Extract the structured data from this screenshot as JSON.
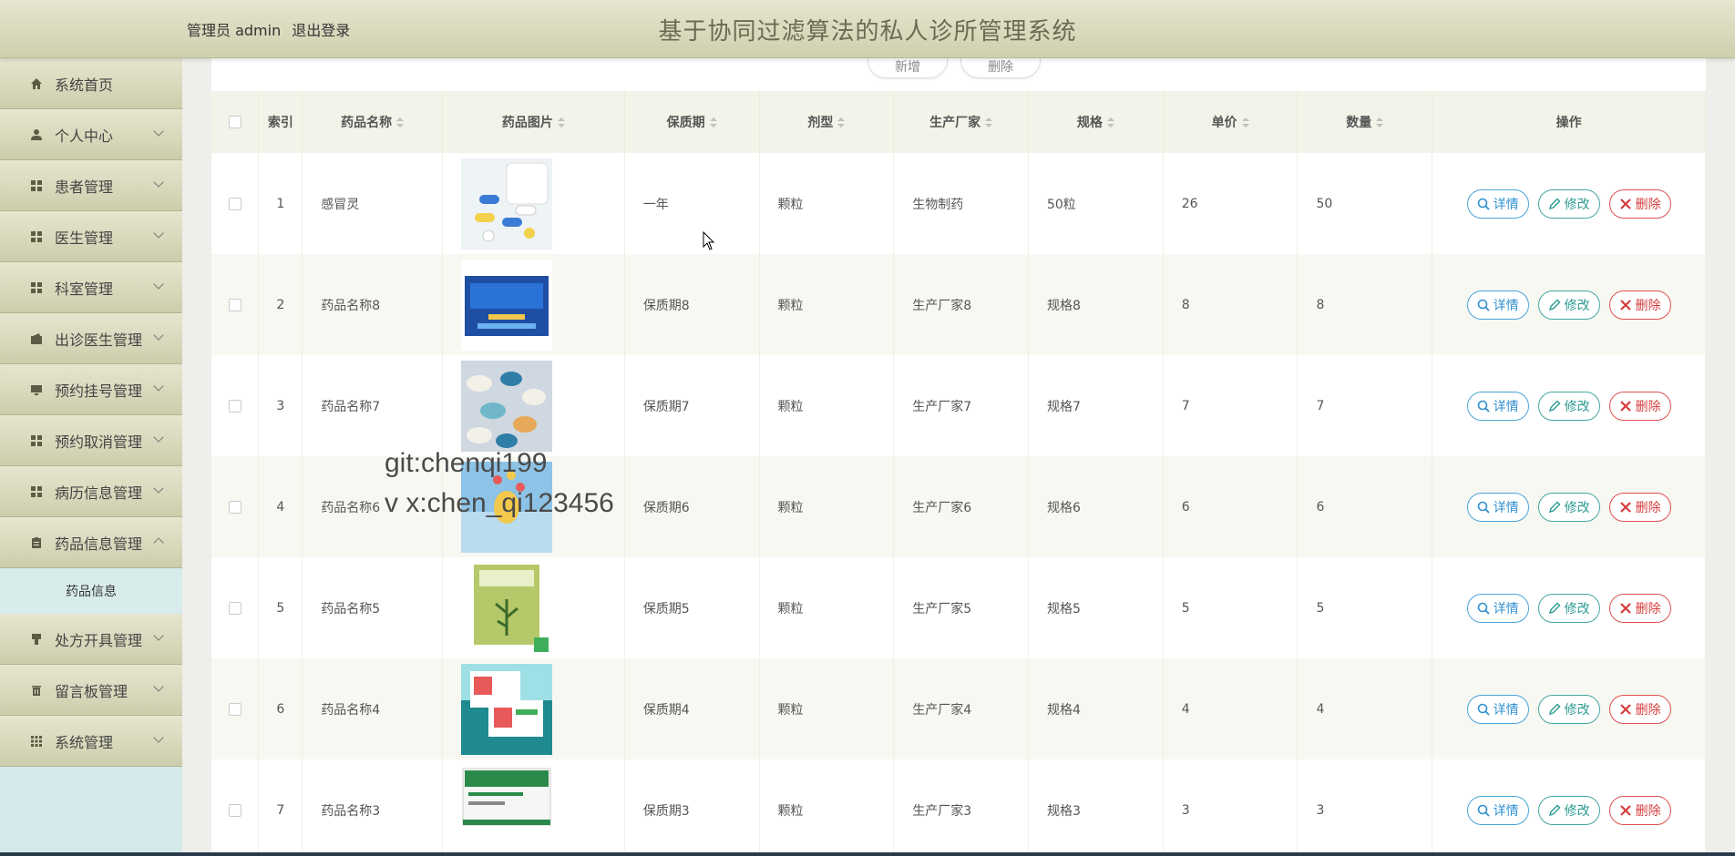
{
  "header": {
    "user_label": "管理员 admin",
    "logout_label": "退出登录",
    "system_title": "基于协同过滤算法的私人诊所管理系统"
  },
  "sidebar": {
    "items": [
      {
        "label": "系统首页",
        "icon": "home-icon"
      },
      {
        "label": "个人中心",
        "icon": "user-icon"
      },
      {
        "label": "患者管理",
        "icon": "grid-icon"
      },
      {
        "label": "医生管理",
        "icon": "grid-icon"
      },
      {
        "label": "科室管理",
        "icon": "grid-icon"
      },
      {
        "label": "出诊医生管理",
        "icon": "wallet-icon"
      },
      {
        "label": "预约挂号管理",
        "icon": "monitor-icon"
      },
      {
        "label": "预约取消管理",
        "icon": "grid-icon"
      },
      {
        "label": "病历信息管理",
        "icon": "grid-icon"
      },
      {
        "label": "药品信息管理",
        "icon": "clipboard-icon"
      },
      {
        "label": "处方开具管理",
        "icon": "tag-icon"
      },
      {
        "label": "留言板管理",
        "icon": "trash-icon"
      },
      {
        "label": "系统管理",
        "icon": "apps-icon"
      }
    ],
    "active_submenu": "药品信息"
  },
  "top_buttons": [
    "新增",
    "删除"
  ],
  "table": {
    "headers": {
      "index": "索引",
      "name": "药品名称",
      "image": "药品图片",
      "shelf_life": "保质期",
      "form": "剂型",
      "manufacturer": "生产厂家",
      "spec": "规格",
      "price": "单价",
      "quantity": "数量",
      "actions": "操作"
    },
    "rows": [
      {
        "index": "1",
        "name": "感冒灵",
        "shelf_life": "一年",
        "form": "颗粒",
        "manufacturer": "生物制药",
        "spec": "50粒",
        "price": "26",
        "quantity": "50"
      },
      {
        "index": "2",
        "name": "药品名称8",
        "shelf_life": "保质期8",
        "form": "颗粒",
        "manufacturer": "生产厂家8",
        "spec": "规格8",
        "price": "8",
        "quantity": "8"
      },
      {
        "index": "3",
        "name": "药品名称7",
        "shelf_life": "保质期7",
        "form": "颗粒",
        "manufacturer": "生产厂家7",
        "spec": "规格7",
        "price": "7",
        "quantity": "7"
      },
      {
        "index": "4",
        "name": "药品名称6",
        "shelf_life": "保质期6",
        "form": "颗粒",
        "manufacturer": "生产厂家6",
        "spec": "规格6",
        "price": "6",
        "quantity": "6"
      },
      {
        "index": "5",
        "name": "药品名称5",
        "shelf_life": "保质期5",
        "form": "颗粒",
        "manufacturer": "生产厂家5",
        "spec": "规格5",
        "price": "5",
        "quantity": "5"
      },
      {
        "index": "6",
        "name": "药品名称4",
        "shelf_life": "保质期4",
        "form": "颗粒",
        "manufacturer": "生产厂家4",
        "spec": "规格4",
        "price": "4",
        "quantity": "4"
      },
      {
        "index": "7",
        "name": "药品名称3",
        "shelf_life": "保质期3",
        "form": "颗粒",
        "manufacturer": "生产厂家3",
        "spec": "规格3",
        "price": "3",
        "quantity": "3"
      }
    ],
    "action_labels": {
      "detail": "详情",
      "edit": "修改",
      "delete": "删除"
    }
  },
  "watermark": {
    "line1": "git:chenqi199",
    "line2": "v x:chen_qi123456"
  },
  "colors": {
    "header_bg": "#dcdcc0",
    "sidebar_bg": "#d3e9ea",
    "detail": "#2f8fd0",
    "edit": "#2c9a92",
    "delete": "#d63c3c"
  }
}
